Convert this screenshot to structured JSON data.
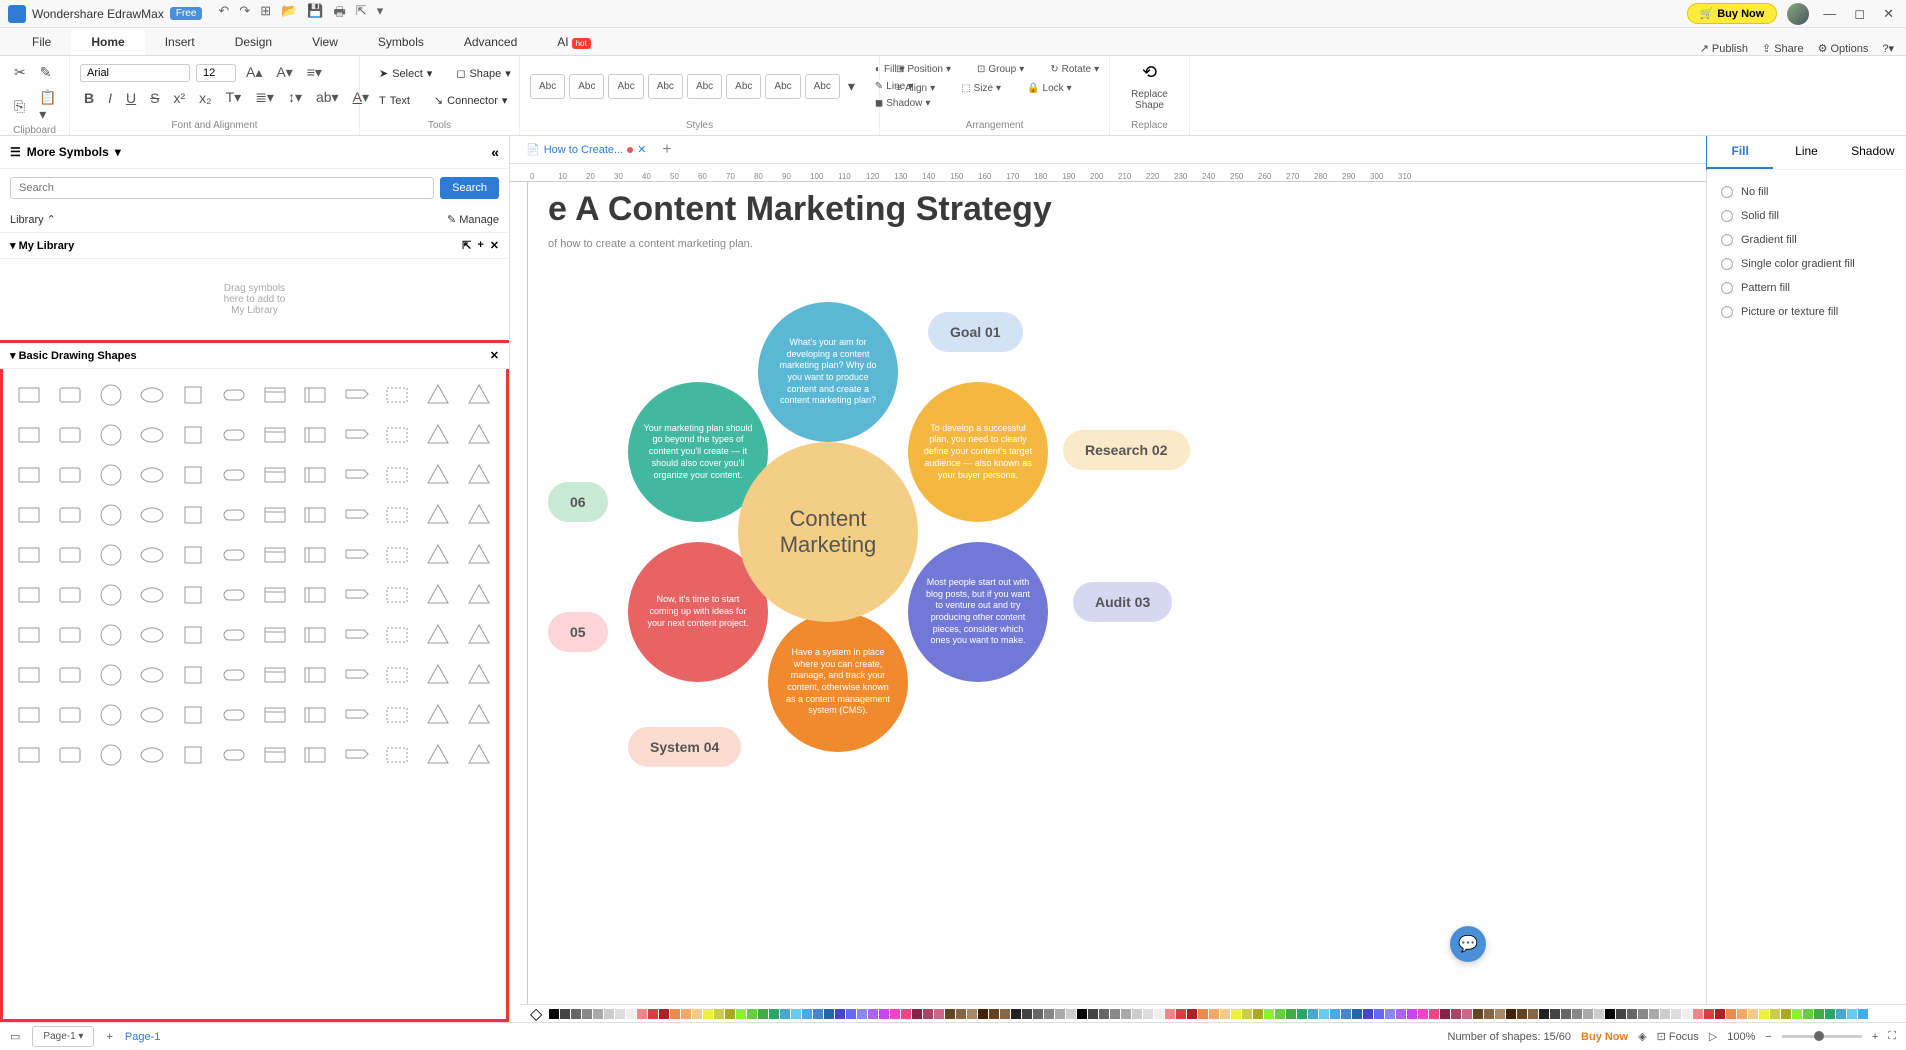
{
  "titlebar": {
    "app_name": "Wondershare EdrawMax",
    "free_badge": "Free",
    "buy_now": "Buy Now"
  },
  "menu": {
    "tabs": [
      "File",
      "Home",
      "Insert",
      "Design",
      "View",
      "Symbols",
      "Advanced",
      "AI"
    ],
    "active": "Home",
    "right": {
      "publish": "Publish",
      "share": "Share",
      "options": "Options"
    },
    "hot": "hot"
  },
  "ribbon": {
    "clipboard_label": "Clipboard",
    "font_label": "Font and Alignment",
    "tools_label": "Tools",
    "styles_label": "Styles",
    "arrangement_label": "Arrangement",
    "replace_label": "Replace",
    "font_name": "Arial",
    "font_size": "12",
    "select": "Select",
    "shape": "Shape",
    "text": "Text",
    "connector": "Connector",
    "abc": "Abc",
    "fill": "Fill",
    "line": "Line",
    "shadow": "Shadow",
    "position": "Position",
    "group": "Group",
    "align": "Align",
    "size": "Size",
    "rotate": "Rotate",
    "lock": "Lock",
    "replace_shape": "Replace\nShape"
  },
  "left": {
    "more_symbols": "More Symbols",
    "search_placeholder": "Search",
    "search_btn": "Search",
    "library": "Library",
    "manage": "Manage",
    "my_library": "My Library",
    "drag_hint": "Drag symbols\nhere to add to\nMy Library",
    "basic_shapes": "Basic Drawing Shapes"
  },
  "doc_tab": "How to Create...",
  "ruler_marks": [
    "0",
    "10",
    "20",
    "30",
    "40",
    "50",
    "60",
    "70",
    "80",
    "90",
    "100",
    "110",
    "120",
    "130",
    "140",
    "150",
    "160",
    "170",
    "180",
    "190",
    "200",
    "210",
    "220",
    "230",
    "240",
    "250",
    "260",
    "270",
    "280",
    "290",
    "300",
    "310"
  ],
  "diagram": {
    "title": "e A Content Marketing Strategy",
    "subtitle": "of how to create a content marketing plan.",
    "center": "Content\nMarketing",
    "petals": {
      "top": "What's your aim for developing a content marketing plan? Why do you want to produce content and create a content marketing plan?",
      "right": "To develop a successful plan, you need to clearly define your content's target audience — also known as your buyer persona.",
      "right2": "Most people start out with blog posts, but if you want to venture out and try producing other content pieces, consider which ones you want to make.",
      "bottom": "Have a system in place where you can create, manage, and track your content, otherwise known as a content management system (CMS).",
      "left2": "Now, it's time to start coming up with ideas for your next content project.",
      "left": "Your marketing plan should go beyond the types of content you'll create — it should also cover you'll organize your content."
    },
    "pills": {
      "goal": "Goal 01",
      "research": "Research 02",
      "audit": "Audit 03",
      "system": "System 04",
      "p05": "05",
      "p06": "06"
    }
  },
  "right_panel": {
    "tabs": [
      "Fill",
      "Line",
      "Shadow"
    ],
    "active": "Fill",
    "options": [
      "No fill",
      "Solid fill",
      "Gradient fill",
      "Single color gradient fill",
      "Pattern fill",
      "Picture or texture fill"
    ]
  },
  "statusbar": {
    "page": "Page-1",
    "page_tab": "Page-1",
    "shapes": "Number of shapes: 15/60",
    "buy_now": "Buy Now",
    "focus": "Focus",
    "zoom": "100%"
  },
  "colors": [
    "#000",
    "#444",
    "#666",
    "#888",
    "#aaa",
    "#ccc",
    "#ddd",
    "#eee",
    "#e88",
    "#c44",
    "#a22",
    "#e84",
    "#ea6",
    "#ec8",
    "#ee4",
    "#cc4",
    "#aa2",
    "#8e4",
    "#6c4",
    "#4a4",
    "#2a6",
    "#4ac",
    "#6ce",
    "#4ae",
    "#48c",
    "#26a",
    "#44c",
    "#66e",
    "#88e",
    "#a6e",
    "#c4e",
    "#e4c",
    "#e48",
    "#824",
    "#a46",
    "#c68",
    "#642",
    "#864",
    "#a86",
    "#420",
    "#642",
    "#864",
    "#222",
    "#444",
    "#666",
    "#888",
    "#aaa",
    "#ccc"
  ]
}
